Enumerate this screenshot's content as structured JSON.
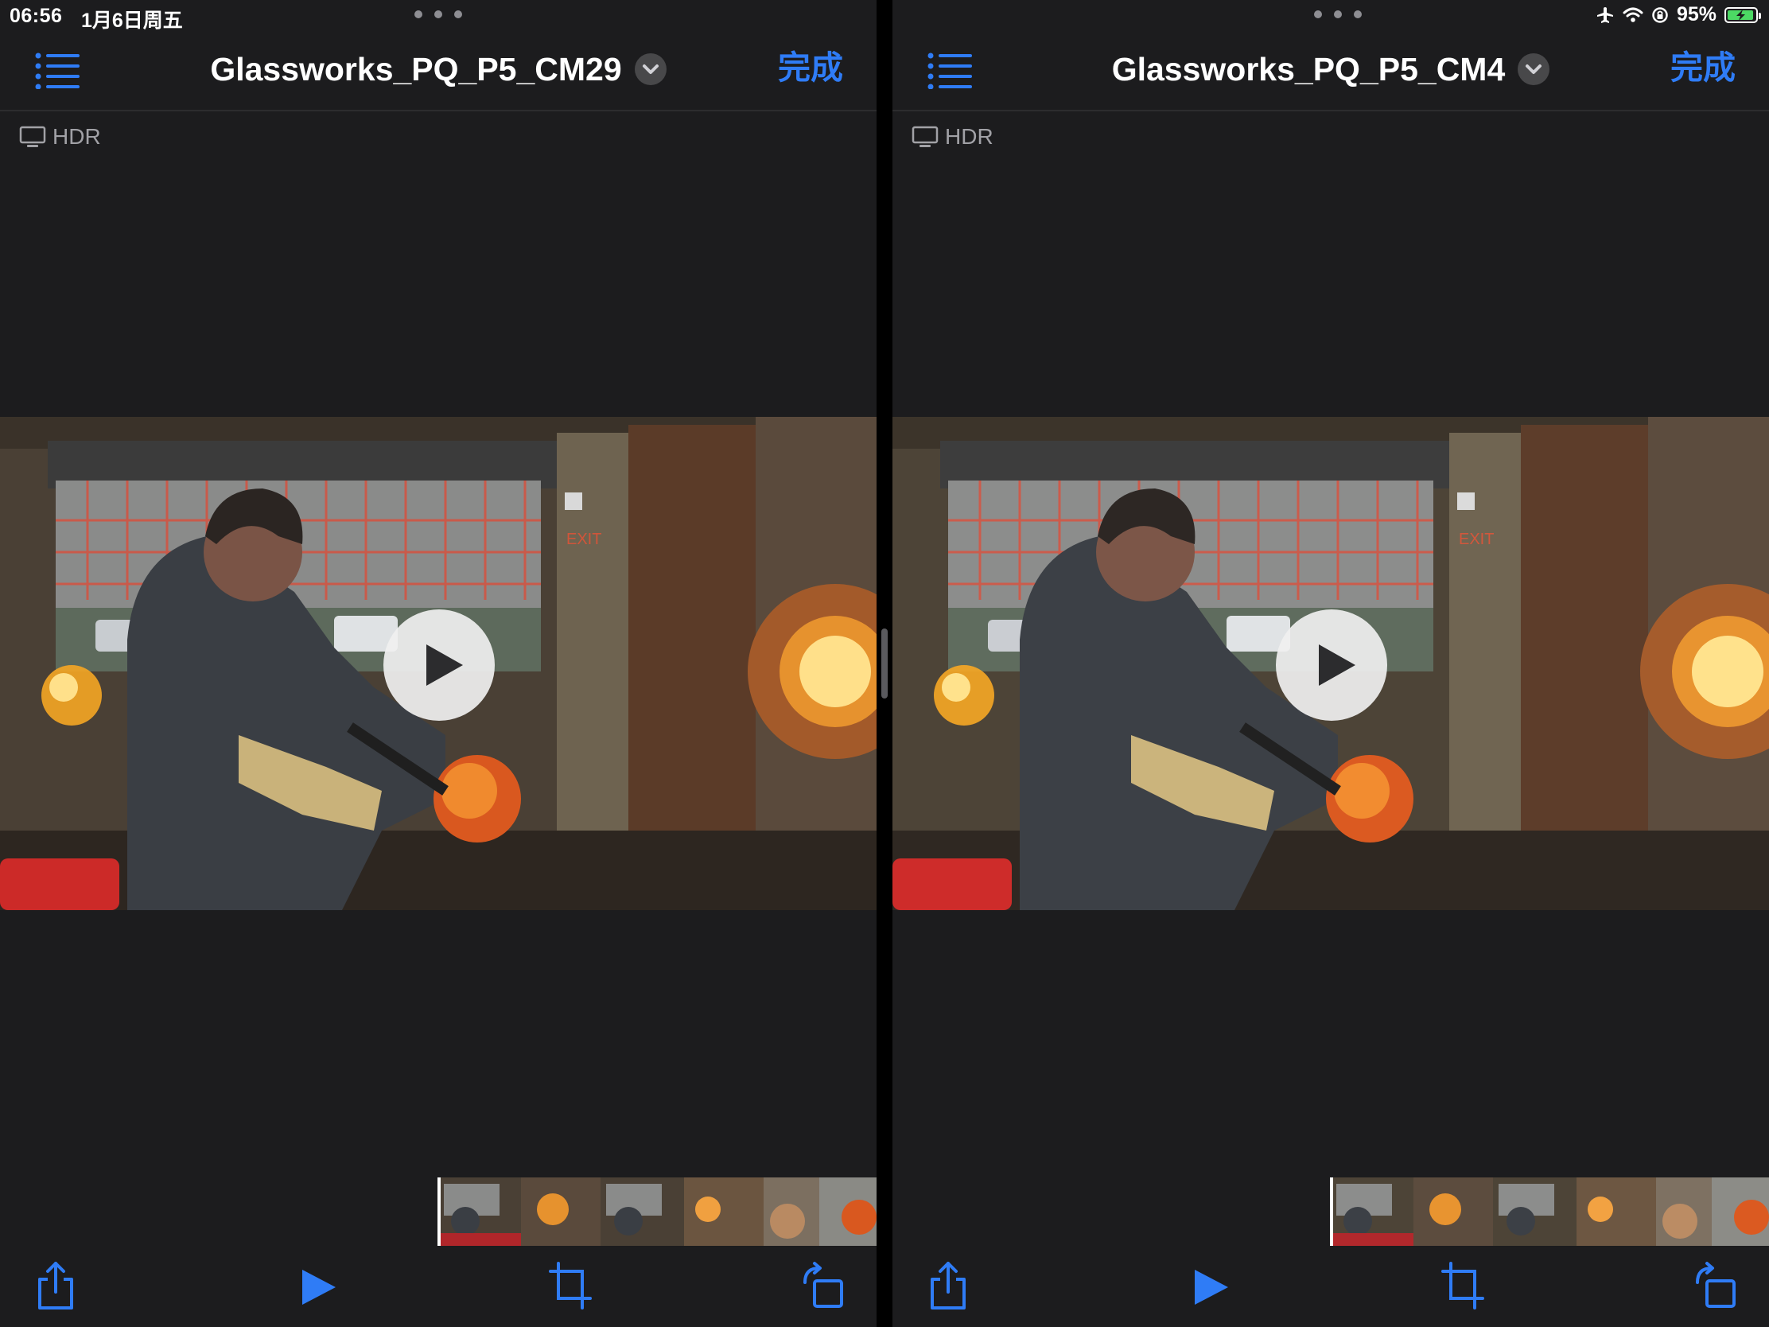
{
  "status": {
    "time": "06:56",
    "date": "1月6日周五",
    "battery_text": "95%",
    "battery_level": 0.95,
    "icons": [
      "airplane-mode-icon",
      "wifi-icon",
      "orientation-lock-icon",
      "battery-charging-icon"
    ]
  },
  "colors": {
    "accent": "#2f7cf6",
    "background": "#1c1c1e",
    "battery_fill": "#4cd964"
  },
  "panes": [
    {
      "title": "Glassworks_PQ_P5_CM29",
      "done_label": "完成",
      "hdr_label": "HDR"
    },
    {
      "title": "Glassworks_PQ_P5_CM4",
      "done_label": "完成",
      "hdr_label": "HDR"
    }
  ],
  "toolbar_icons": [
    "share-icon",
    "play-icon",
    "crop-icon",
    "rotate-icon"
  ]
}
